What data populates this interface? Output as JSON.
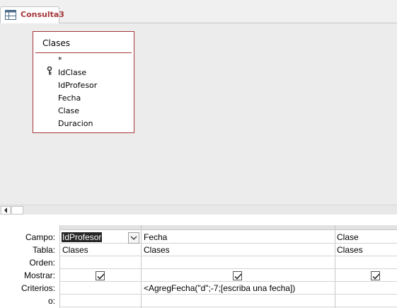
{
  "tab": {
    "label": "Consulta3",
    "icon": "query-icon"
  },
  "table": {
    "title": "Clases",
    "fields": [
      "*",
      "IdClase",
      "IdProfesor",
      "Fecha",
      "Clase",
      "Duracion"
    ],
    "key_field": "IdClase"
  },
  "grid": {
    "row_labels": {
      "campo": "Campo:",
      "tabla": "Tabla:",
      "orden": "Orden:",
      "mostrar": "Mostrar:",
      "criterios": "Criterios:",
      "o": "o:"
    },
    "columns": [
      {
        "campo": "IdProfesor",
        "tabla": "Clases",
        "orden": "",
        "mostrar": true,
        "criterios": "",
        "o": ""
      },
      {
        "campo": "Fecha",
        "tabla": "Clases",
        "orden": "",
        "mostrar": true,
        "criterios": "<AgregFecha(\"d\";-7;[escriba una fecha])",
        "o": ""
      },
      {
        "campo": "Clase",
        "tabla": "Clases",
        "orden": "",
        "mostrar": true,
        "criterios": "",
        "o": ""
      }
    ]
  }
}
